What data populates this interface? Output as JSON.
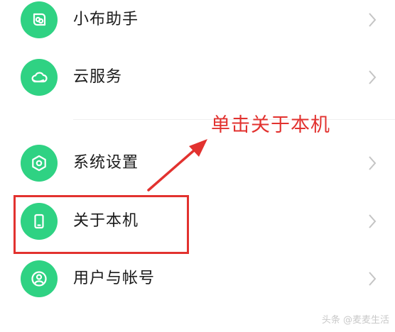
{
  "settings": {
    "items": [
      {
        "label": "小布助手",
        "icon": "assistant-icon"
      },
      {
        "label": "云服务",
        "icon": "cloud-icon"
      },
      {
        "label": "系统设置",
        "icon": "hexagon-gear-icon"
      },
      {
        "label": "关于本机",
        "icon": "phone-icon"
      },
      {
        "label": "用户与帐号",
        "icon": "user-icon"
      }
    ]
  },
  "annotation": {
    "text": "单击关于本机",
    "highlighted_item": "关于本机"
  },
  "watermark": "头条 @麦麦生活",
  "colors": {
    "icon_bg": "#2fd283",
    "annotation": "#e2322f",
    "chevron": "#c4c4c4",
    "text": "#1a1a1a"
  }
}
